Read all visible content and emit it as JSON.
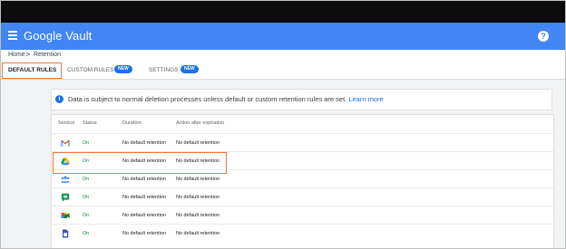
{
  "header": {
    "app_title": "Google Vault",
    "help_glyph": "?"
  },
  "breadcrumb": {
    "home": "Home",
    "separator": ">",
    "current": "Retention"
  },
  "tabs": [
    {
      "label": "DEFAULT RULES",
      "badge": ""
    },
    {
      "label": "CUSTOM RULES",
      "badge": "NEW"
    },
    {
      "label": "SETTINGS",
      "badge": "NEW"
    }
  ],
  "info": {
    "icon_glyph": "i",
    "text": "Data is subject to normal deletion processes unless default or custom retention rules are set.",
    "link": "Learn more"
  },
  "table": {
    "headers": [
      "Service",
      "Status",
      "Duration",
      "Action after expiration"
    ],
    "rows": [
      {
        "icon": "gmail-icon",
        "status": "On",
        "duration": "No default retention",
        "action": "No default retention"
      },
      {
        "icon": "google-drive-icon",
        "status": "On",
        "duration": "No default retention",
        "action": "No default retention"
      },
      {
        "icon": "groups-icon",
        "status": "On",
        "duration": "No default retention",
        "action": "No default retention"
      },
      {
        "icon": "chat-icon",
        "status": "On",
        "duration": "No default retention",
        "action": "No default retention"
      },
      {
        "icon": "meet-icon",
        "status": "On",
        "duration": "No default retention",
        "action": "No default retention"
      },
      {
        "icon": "sites-icon",
        "status": "On",
        "duration": "No default retention",
        "action": "No default retention"
      }
    ]
  },
  "colors": {
    "app_bar": "#4285f4",
    "highlight": "#e8793b",
    "status_on": "#188038",
    "badge": "#1a73e8"
  }
}
